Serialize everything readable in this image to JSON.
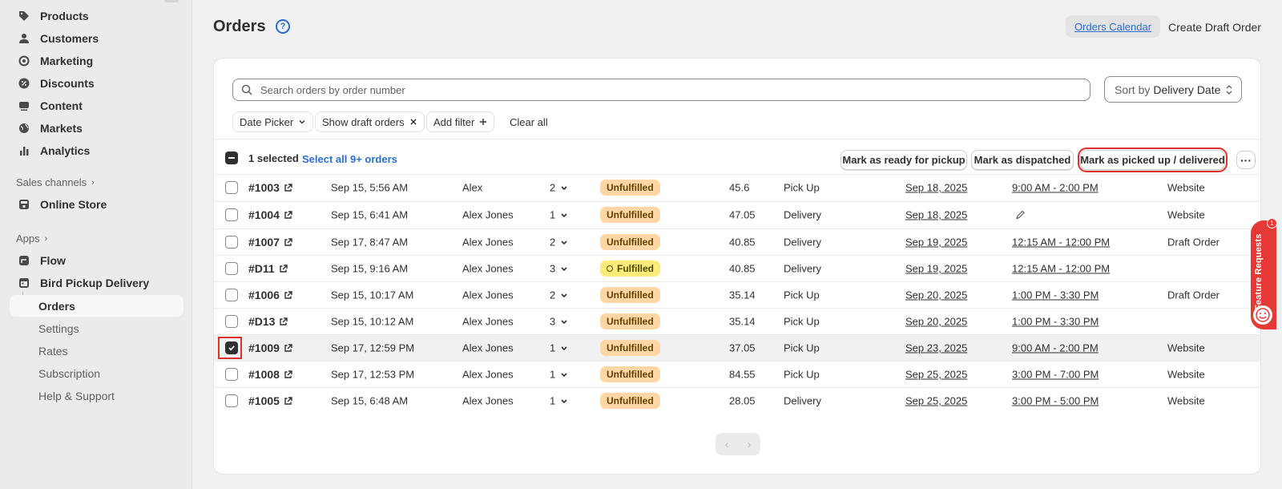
{
  "sidebar": {
    "items": [
      {
        "label": "Products",
        "icon": "tag-icon"
      },
      {
        "label": "Customers",
        "icon": "person-icon"
      },
      {
        "label": "Marketing",
        "icon": "target-icon"
      },
      {
        "label": "Discounts",
        "icon": "discount-icon"
      },
      {
        "label": "Content",
        "icon": "content-icon"
      },
      {
        "label": "Markets",
        "icon": "globe-icon"
      },
      {
        "label": "Analytics",
        "icon": "bar-chart-icon"
      }
    ],
    "sales_channels_label": "Sales channels",
    "online_store_label": "Online Store",
    "apps_label": "Apps",
    "flow_label": "Flow",
    "app_label": "Bird Pickup Delivery",
    "app_subitems": [
      "Orders",
      "Settings",
      "Rates",
      "Subscription",
      "Help & Support"
    ]
  },
  "header": {
    "title": "Orders",
    "calendar_button": "Orders Calendar",
    "draft_button": "Create Draft Order"
  },
  "search": {
    "placeholder": "Search orders by order number"
  },
  "sort": {
    "label": "Sort by",
    "value": "Delivery Date"
  },
  "filters": {
    "date_picker": "Date Picker",
    "show_draft": "Show draft orders",
    "add_filter": "Add filter",
    "clear_all": "Clear all"
  },
  "bulk": {
    "selected": "1 selected",
    "select_all": "Select all 9+ orders",
    "ready_pickup": "Mark as ready for pickup",
    "dispatched": "Mark as dispatched",
    "picked_up": "Mark as picked up / delivered"
  },
  "orders": [
    {
      "num": "#1003",
      "date": "Sep 15, 5:56 AM",
      "customer": "Alex",
      "qty": "2",
      "status": "Unfulfilled",
      "total": "45.6",
      "type": "Pick Up",
      "delivery_date": "Sep 18, 2025",
      "time": "9:00 AM - 2:00 PM",
      "source": "Website",
      "selected": false
    },
    {
      "num": "#1004",
      "date": "Sep 15, 6:41 AM",
      "customer": "Alex Jones",
      "qty": "1",
      "status": "Unfulfilled",
      "total": "47.05",
      "type": "Delivery",
      "delivery_date": "Sep 18, 2025",
      "time": "",
      "source": "Website",
      "selected": false
    },
    {
      "num": "#1007",
      "date": "Sep 17, 8:47 AM",
      "customer": "Alex Jones",
      "qty": "2",
      "status": "Unfulfilled",
      "total": "40.85",
      "type": "Delivery",
      "delivery_date": "Sep 19, 2025",
      "time": "12:15 AM - 12:00 PM",
      "source": "Draft Order",
      "selected": false
    },
    {
      "num": "#D11",
      "date": "Sep 15, 9:16 AM",
      "customer": "Alex Jones",
      "qty": "3",
      "status": "Fulfilled",
      "total": "40.85",
      "type": "Delivery",
      "delivery_date": "Sep 19, 2025",
      "time": "12:15 AM - 12:00 PM",
      "source": "",
      "selected": false
    },
    {
      "num": "#1006",
      "date": "Sep 15, 10:17 AM",
      "customer": "Alex Jones",
      "qty": "2",
      "status": "Unfulfilled",
      "total": "35.14",
      "type": "Pick Up",
      "delivery_date": "Sep 20, 2025",
      "time": "1:00 PM - 3:30 PM",
      "source": "Draft Order",
      "selected": false
    },
    {
      "num": "#D13",
      "date": "Sep 15, 10:12 AM",
      "customer": "Alex Jones",
      "qty": "3",
      "status": "Unfulfilled",
      "total": "35.14",
      "type": "Pick Up",
      "delivery_date": "Sep 20, 2025",
      "time": "1:00 PM - 3:30 PM",
      "source": "",
      "selected": false
    },
    {
      "num": "#1009",
      "date": "Sep 17, 12:59 PM",
      "customer": "Alex Jones",
      "qty": "1",
      "status": "Unfulfilled",
      "total": "37.05",
      "type": "Pick Up",
      "delivery_date": "Sep 23, 2025",
      "time": "9:00 AM - 2:00 PM",
      "source": "Website",
      "selected": true
    },
    {
      "num": "#1008",
      "date": "Sep 17, 12:53 PM",
      "customer": "Alex Jones",
      "qty": "1",
      "status": "Unfulfilled",
      "total": "84.55",
      "type": "Pick Up",
      "delivery_date": "Sep 25, 2025",
      "time": "3:00 PM - 7:00 PM",
      "source": "Website",
      "selected": false
    },
    {
      "num": "#1005",
      "date": "Sep 15, 6:48 AM",
      "customer": "Alex Jones",
      "qty": "1",
      "status": "Unfulfilled",
      "total": "28.05",
      "type": "Delivery",
      "delivery_date": "Sep 25, 2025",
      "time": "3:00 PM - 5:00 PM",
      "source": "Website",
      "selected": false
    }
  ],
  "feature_tab": {
    "label": "Feature Requests",
    "count": "1"
  },
  "colors": {
    "accent": "#2c6ecb",
    "highlight": "#e03131",
    "unfulfilled": "#ffd6a4",
    "fulfilled": "#ffeb78",
    "feature": "#e53935"
  }
}
